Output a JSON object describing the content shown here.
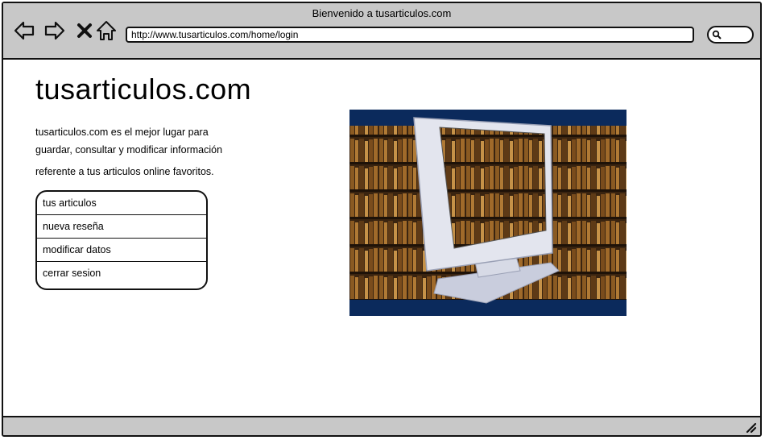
{
  "window": {
    "title": "Bienvenido a tusarticulos.com"
  },
  "address_bar": {
    "url": "http://www.tusarticulos.com/home/login"
  },
  "site": {
    "title": "tusarticulos.com",
    "description": [
      "tusarticulos.com es el mejor lugar para",
      "guardar, consultar y modificar información",
      "referente a tus articulos online favoritos."
    ]
  },
  "menu": {
    "items": [
      {
        "label": "tus articulos"
      },
      {
        "label": "nueva reseña"
      },
      {
        "label": "modificar datos"
      },
      {
        "label": "cerrar sesion"
      }
    ]
  },
  "colors": {
    "chrome": "#c8c8c8",
    "border": "#111111",
    "hero_background": "#0b2a5c"
  },
  "icons": [
    "back-arrow-icon",
    "forward-arrow-icon",
    "stop-icon",
    "home-icon",
    "search-icon",
    "resize-grip-icon"
  ]
}
